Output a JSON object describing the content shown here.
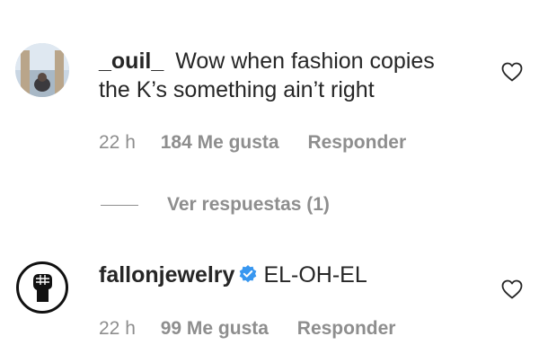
{
  "comments": [
    {
      "username": "_ouil_",
      "text_line1": "Wow when fashion copies",
      "text_line2": "the K’s something ain’t right",
      "time": "22 h",
      "likes": "184 Me gusta",
      "reply": "Responder",
      "avatar_icon": "profile-photo",
      "like_icon": "heart-outline-icon"
    },
    {
      "username": "fallonjewelry",
      "verified": true,
      "verified_icon": "verified-badge-icon",
      "text": "EL-OH-EL",
      "time": "22 h",
      "likes": "99 Me gusta",
      "reply": "Responder",
      "avatar_icon": "raised-fist-icon",
      "like_icon": "heart-outline-icon"
    }
  ],
  "replies_toggle": {
    "label": "Ver respuestas (1)"
  },
  "colors": {
    "text": "#262626",
    "muted": "#8e8e8e",
    "verified_blue": "#3897f0"
  }
}
